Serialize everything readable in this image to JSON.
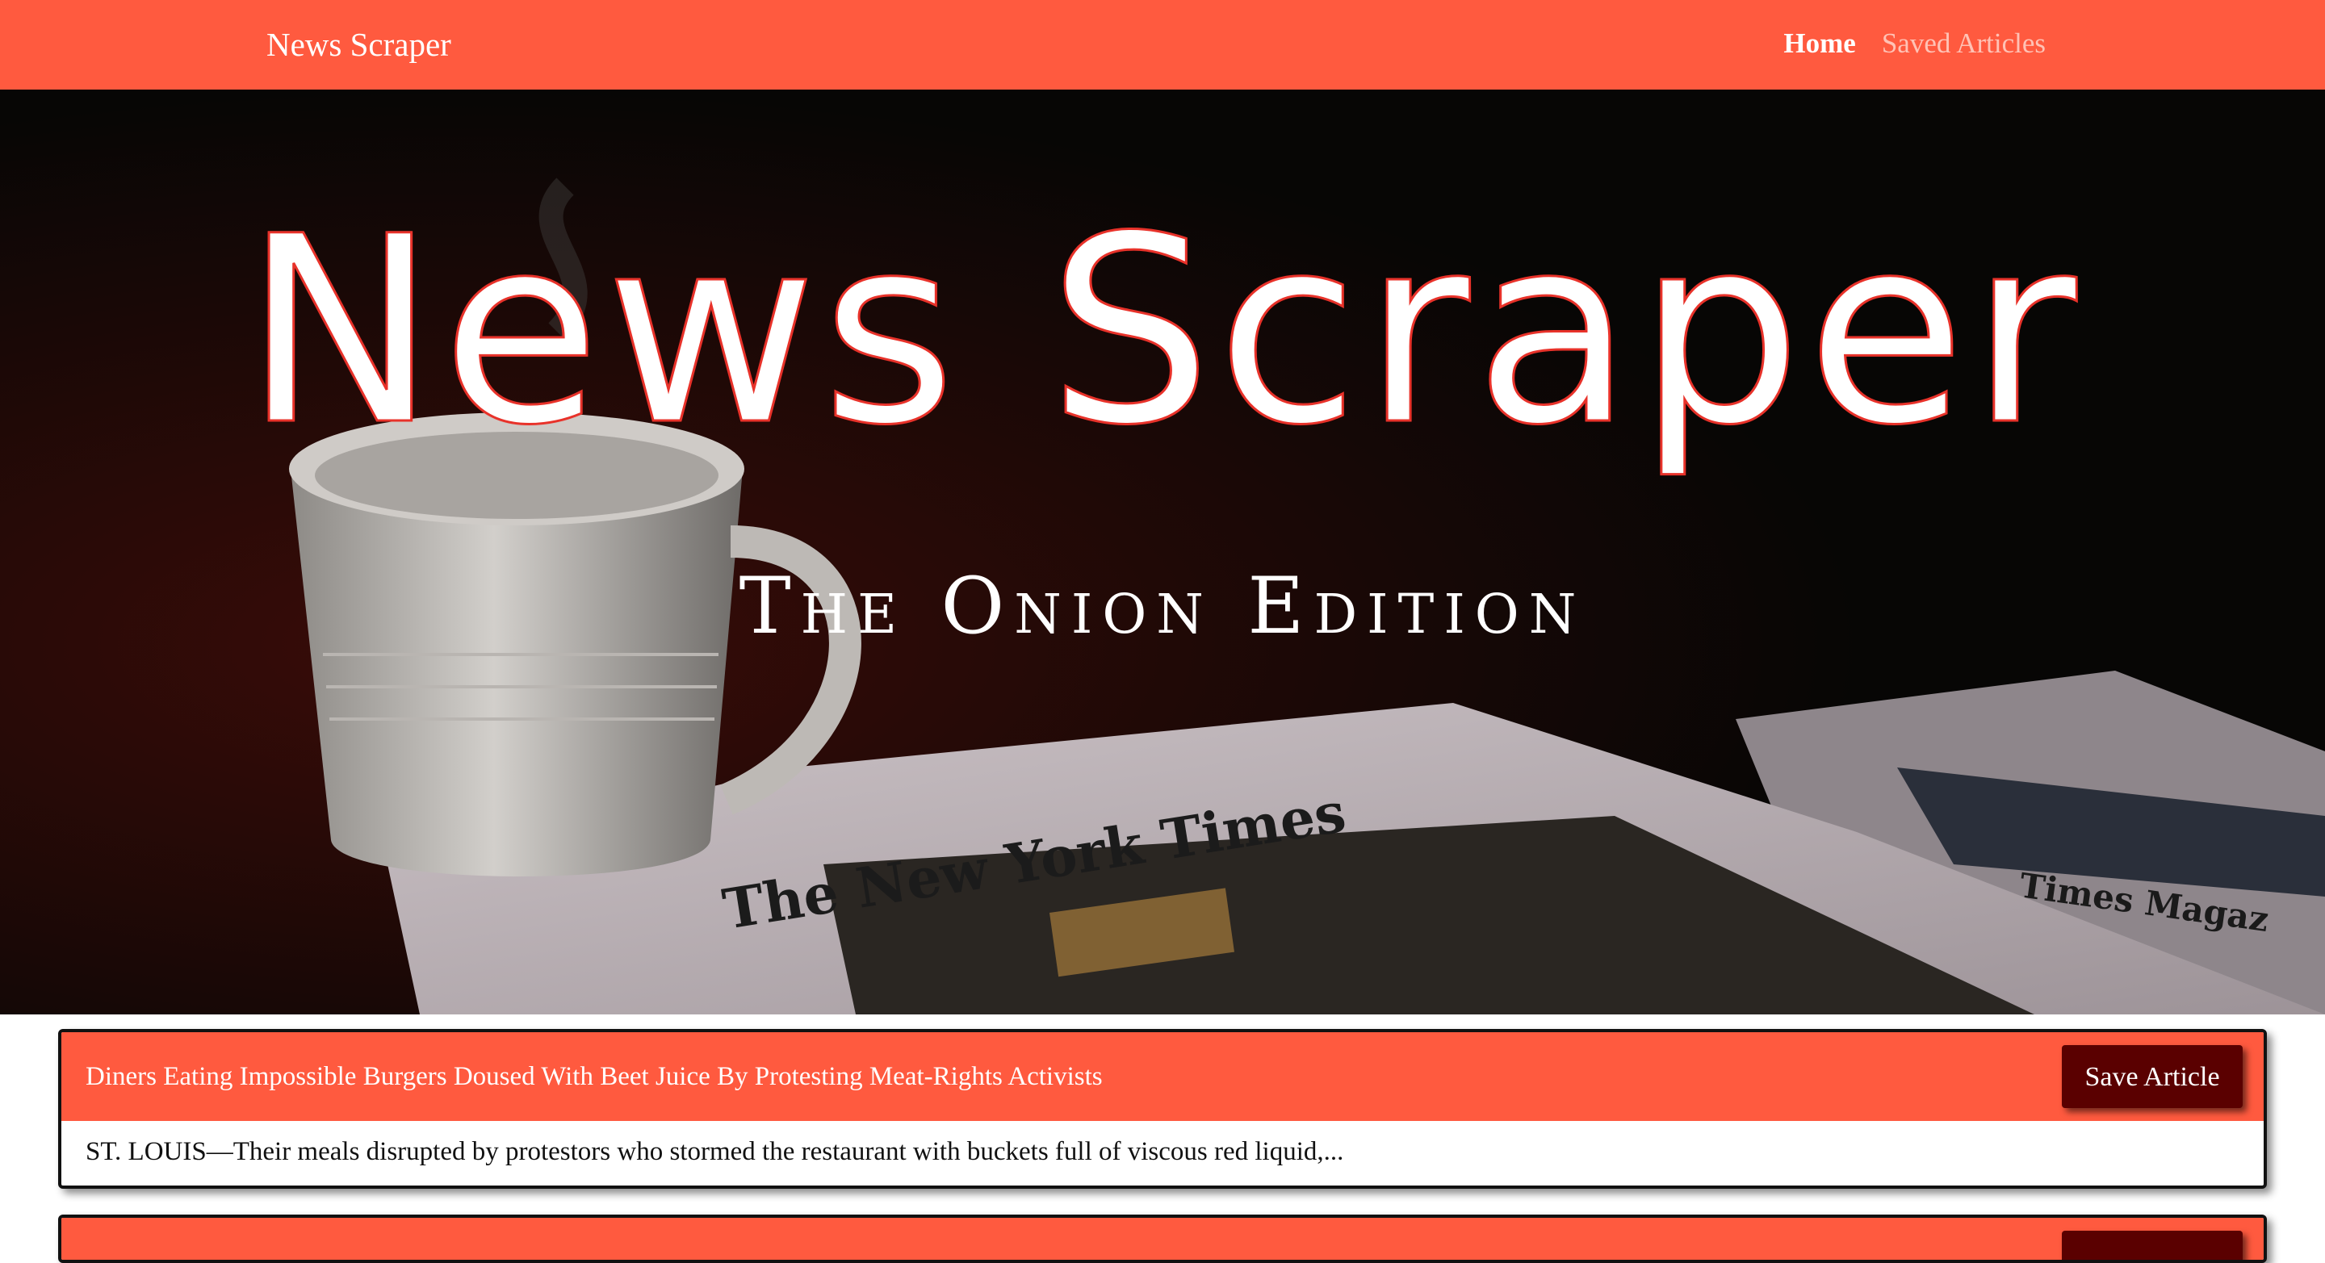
{
  "navbar": {
    "brand": "News Scraper",
    "links": [
      {
        "label": "Home",
        "active": true
      },
      {
        "label": "Saved Articles",
        "active": false
      }
    ]
  },
  "hero": {
    "title": "News Scraper",
    "subtitle": "The Onion Edition",
    "newspaper_masthead": "The New York Times",
    "background_colors": {
      "dark": "#070605",
      "paper": "#bfb5bb"
    }
  },
  "articles": [
    {
      "title": "Diners Eating Impossible Burgers Doused With Beet Juice By Protesting Meat-Rights Activists",
      "summary": "ST. LOUIS—Their meals disrupted by protestors who stormed the restaurant with buckets full of viscous red liquid,...",
      "save_label": "Save Article"
    },
    {
      "title": "",
      "summary": "",
      "save_label": ""
    }
  ],
  "colors": {
    "accent": "#ff5a3f",
    "button": "#5a0000",
    "text": "#111111"
  }
}
